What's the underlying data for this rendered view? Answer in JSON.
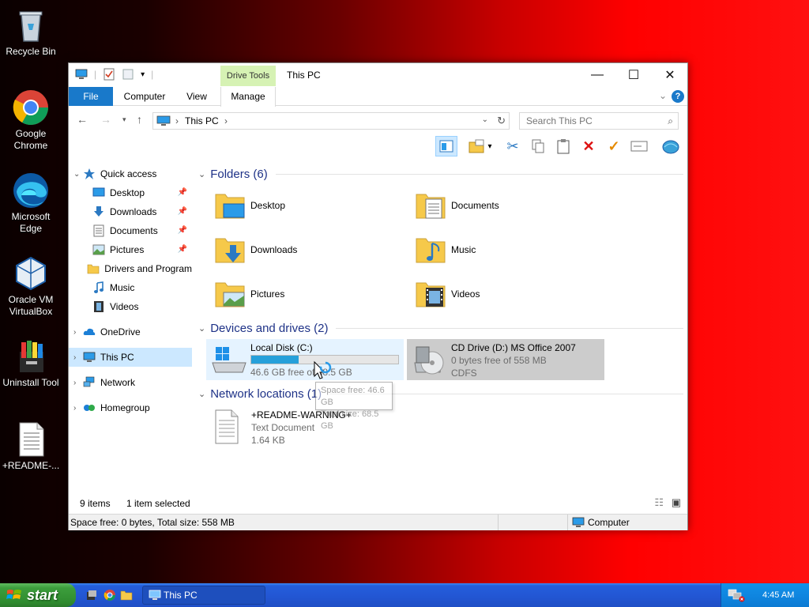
{
  "desktop": {
    "icons": [
      {
        "label": "Recycle Bin"
      },
      {
        "label": "Google Chrome"
      },
      {
        "label": "Microsoft Edge"
      },
      {
        "label": "Oracle VM VirtualBox"
      },
      {
        "label": "Uninstall Tool"
      },
      {
        "label": "+README-..."
      }
    ]
  },
  "window": {
    "title": "This PC",
    "contextual_tab": "Drive Tools",
    "tabs": {
      "file": "File",
      "computer": "Computer",
      "view": "View",
      "manage": "Manage"
    },
    "address": {
      "crumb": "This PC"
    },
    "search": {
      "placeholder": "Search This PC"
    },
    "nav": {
      "quick_access": "Quick access",
      "desktop": "Desktop",
      "downloads": "Downloads",
      "documents": "Documents",
      "pictures": "Pictures",
      "drivers": "Drivers and Program",
      "music": "Music",
      "videos": "Videos",
      "onedrive": "OneDrive",
      "this_pc": "This PC",
      "network": "Network",
      "homegroup": "Homegroup"
    },
    "folders_header": "Folders (6)",
    "folders": {
      "desktop": "Desktop",
      "documents": "Documents",
      "downloads": "Downloads",
      "music": "Music",
      "pictures": "Pictures",
      "videos": "Videos"
    },
    "devices_header": "Devices and drives (2)",
    "local_disk": {
      "name": "Local Disk (C:)",
      "free_text": "46.6 GB free of 68.5 GB",
      "used_fraction": 0.32
    },
    "cd_drive": {
      "name": "CD Drive (D:) MS Office 2007",
      "free_text": "0 bytes free of 558 MB",
      "fs": "CDFS"
    },
    "tooltip": {
      "line1": "Space free: 46.6 GB",
      "line2": "Total size: 68.5 GB"
    },
    "network_header": "Network locations (1)",
    "network_file": {
      "name": "+README-WARNING+",
      "type": "Text Document",
      "size": "1.64 KB"
    },
    "status": {
      "items": "9 items",
      "selected": "1 item selected"
    },
    "bottom": {
      "space": "Space free: 0 bytes, Total size: 558 MB",
      "location": "Computer"
    }
  },
  "taskbar": {
    "start": "start",
    "task": "This PC",
    "clock": "4:45 AM"
  },
  "colors": {
    "accent": "#1979ca",
    "selection": "#cce8ff",
    "progress": "#26a0da",
    "header_text": "#1e3287"
  }
}
